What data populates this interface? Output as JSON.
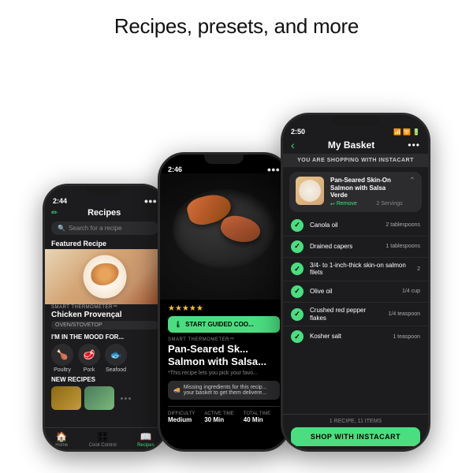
{
  "header": {
    "title": "Recipes, presets, and more"
  },
  "phone_left": {
    "status": "2:44",
    "screen_title": "Recipes",
    "search_placeholder": "Search for a recipe",
    "featured_label": "Featured Recipe",
    "recipe_tag": "SMART THERMOMETER™",
    "recipe_name": "Chicken Provençal",
    "recipe_method": "OVEN/STOVETOP",
    "mood_title": "I'M IN THE MOOD FOR...",
    "mood_items": [
      {
        "label": "Poultry",
        "icon": "🍗"
      },
      {
        "label": "Pork",
        "icon": "🥩"
      },
      {
        "label": "Seafood",
        "icon": "🐟"
      }
    ],
    "new_recipes_label": "NEW RECIPES",
    "nav": [
      {
        "label": "Home",
        "icon": "🏠",
        "active": false
      },
      {
        "label": "Cook Control",
        "icon": "🎛",
        "active": false
      },
      {
        "label": "Recipes",
        "icon": "📖",
        "active": true
      }
    ]
  },
  "phone_middle": {
    "status": "2:46",
    "stars": "★★★★★",
    "start_cooking_label": "START GUIDED COO...",
    "recipe_tag": "SMART THERMOMETER™",
    "recipe_name": "Pan-Seared Sk... Salmon with Salsa...",
    "recipe_name_full": "Pan-Seared Skin-On Salmon with Salsa Verde",
    "note": "*This recipe lets you pick your favo...",
    "missing_text": "Missing ingredients for this recip... your basket to get them delivere...",
    "stats": [
      {
        "label": "DIFFICULTY",
        "value": "Medium"
      },
      {
        "label": "ACTIVE TIME",
        "value": "30 Min"
      },
      {
        "label": "TOTAL TI...",
        "value": "40 Min"
      }
    ]
  },
  "phone_right": {
    "status": "2:50",
    "title": "My Basket",
    "more_icon": "•••",
    "instacart_banner": "YOU ARE SHOPPING WITH INSTACART",
    "recipe_name": "Pan-Seared Skin-On Salmon with Salsa Verde",
    "remove_label": "Remove",
    "servings_label": "2 Servings",
    "ingredients": [
      {
        "name": "Canola oil",
        "amount": "2 tablespoons",
        "checked": true
      },
      {
        "name": "Drained capers",
        "amount": "1 tablespoons",
        "checked": true
      },
      {
        "name": "3/4- to 1-inch-thick skin-on salmon filets",
        "amount": "2",
        "checked": true
      },
      {
        "name": "Olive oil",
        "amount": "1/4 cup",
        "checked": true
      },
      {
        "name": "Crushed red pepper flakes",
        "amount": "1/4 teaspoon",
        "checked": true
      },
      {
        "name": "Kosher salt",
        "amount": "1 teaspoon",
        "checked": true
      }
    ],
    "footer_count": "1 RECIPE, 11 ITEMS",
    "shop_button": "SHOP WITH INSTACART"
  }
}
